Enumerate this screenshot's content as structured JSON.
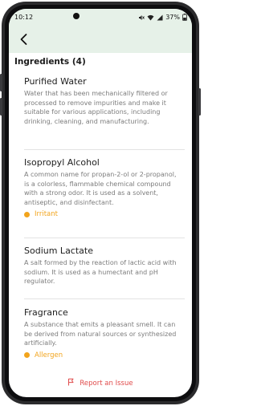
{
  "status_bar": {
    "time": "10:12",
    "battery": "37%",
    "icons": [
      "mute-icon",
      "wifi-icon",
      "signal-icon",
      "battery-icon"
    ]
  },
  "header": {
    "back_icon": "back-arrow-icon",
    "background_color": "#e6f1e8"
  },
  "section": {
    "title": "Ingredients (4)"
  },
  "ingredients": [
    {
      "name": "Purified Water",
      "description": "Water that has been mechanically filtered or processed to remove impurities and make it suitable for various applications, including drinking, cleaning, and manufacturing.",
      "tag": ""
    },
    {
      "name": "Isopropyl Alcohol",
      "description": "A common name for propan-2-ol or 2-propanol, is a colorless, flammable chemical compound with a strong odor. It is used as a solvent, antiseptic, and disinfectant.",
      "tag": "Irritant"
    },
    {
      "name": "Sodium Lactate",
      "description": "A salt formed by the reaction of lactic acid with sodium. It is used as a humectant and pH regulator.",
      "tag": ""
    },
    {
      "name": "Fragrance",
      "description": "A substance that emits a pleasant smell. It can be derived from natural sources or synthesized artificially.",
      "tag": "Allergen"
    }
  ],
  "footer": {
    "report_label": "Report an Issue",
    "report_icon": "flag-icon"
  },
  "colors": {
    "tag": "#f2a41c",
    "report": "#e04b4b",
    "header": "#e6f1e8"
  }
}
